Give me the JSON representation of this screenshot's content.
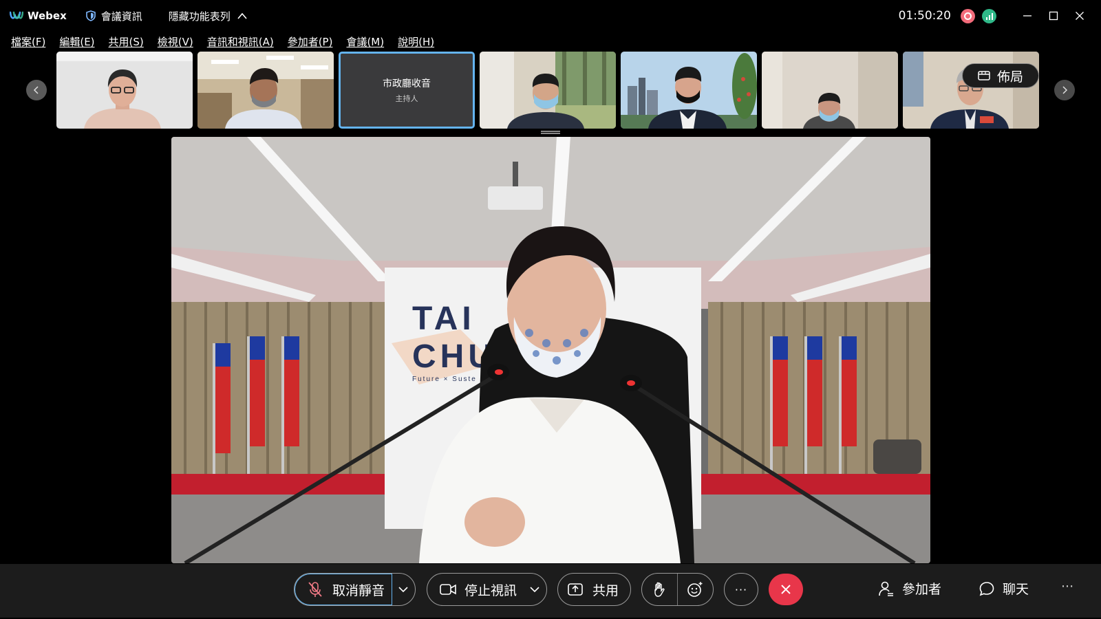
{
  "app": {
    "name": "Webex"
  },
  "titlebar": {
    "meeting_info": "會議資訊",
    "hide_menu": "隱藏功能表列",
    "clock": "01:50:20"
  },
  "menu": {
    "items": [
      "檔案(F)",
      "編輯(E)",
      "共用(S)",
      "檢視(V)",
      "音訊和視訊(A)",
      "參加者(P)",
      "會議(M)",
      "說明(H)"
    ]
  },
  "thumbnails": {
    "host_name": "市政廳收音",
    "host_role": "主持人",
    "layout_label": "佈局"
  },
  "main_video": {
    "backdrop_text_line1": "TAI",
    "backdrop_text_line2": "CHU",
    "backdrop_tagline": "Future × Suste"
  },
  "toolbar": {
    "unmute": "取消靜音",
    "stop_video": "停止視訊",
    "share": "共用",
    "more": "···",
    "participants": "參加者",
    "chat": "聊天",
    "overflow": "···"
  },
  "colors": {
    "host_border": "#64b4f0",
    "end_call": "#e8364a",
    "record": "#f26b7a",
    "signal": "#2fb888"
  }
}
